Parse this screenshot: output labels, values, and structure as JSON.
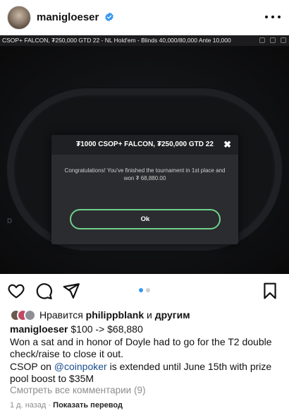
{
  "post": {
    "username": "manigloeser",
    "more_label": "•••"
  },
  "media": {
    "title_bar": "CSOP+ FALCON, ₮250,000 GTD 22 - NL Hold'em - Blinds 40,000/80,000 Ante 10,000",
    "seat_label": "D",
    "dialog": {
      "title": "₮1000 CSOP+ FALCON, ₮250,000 GTD 22",
      "close": "✖",
      "message": "Congratulations! You've finished the tournament in 1st place and won ₮ 68,880.00",
      "ok_label": "Ok"
    }
  },
  "actions": {
    "like_icon": "heart-icon",
    "comment_icon": "comment-icon",
    "share_icon": "send-icon",
    "save_icon": "bookmark-icon",
    "carousel_index": 1,
    "carousel_total": 2
  },
  "likes": {
    "prefix": "Нравится",
    "user": "philippblank",
    "conj": "и",
    "others": "другим"
  },
  "caption": {
    "username": "manigloeser",
    "line1": "$100 -> $68,880",
    "line2": "Won a sat and in honor of Doyle had to go for the T2 double check/raise to close it out.",
    "line3_pre": "CSOP on ",
    "mention": "@coinpoker",
    "line3_post": " is extended until June 15th with prize pool boost to $35M"
  },
  "comments_link": "Смотреть все комментарии (9)",
  "meta": {
    "time": "1 д. назад",
    "separator": "·",
    "translate": "Показать перевод"
  },
  "colors": {
    "verified": "#3897f0",
    "ok_border": "#6fd08a",
    "mention": "#1b4e8f"
  }
}
